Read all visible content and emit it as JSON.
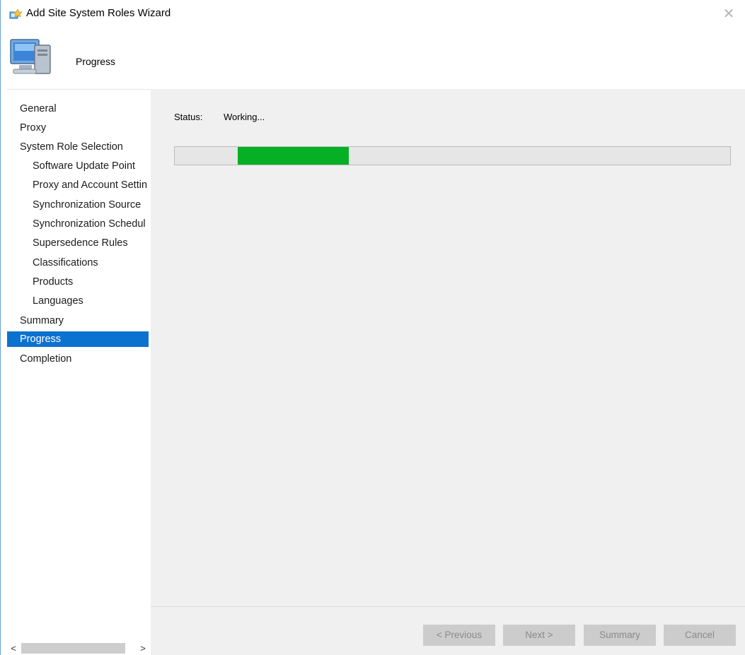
{
  "window": {
    "title": "Add Site System Roles Wizard"
  },
  "header": {
    "title": "Progress"
  },
  "nav": {
    "items": [
      {
        "label": "General"
      },
      {
        "label": "Proxy"
      },
      {
        "label": "System Role Selection"
      },
      {
        "label": "Software Update Point"
      },
      {
        "label": "Proxy and Account Settin"
      },
      {
        "label": "Synchronization Source"
      },
      {
        "label": "Synchronization Schedul"
      },
      {
        "label": "Supersedence Rules"
      },
      {
        "label": "Classifications"
      },
      {
        "label": "Products"
      },
      {
        "label": "Languages"
      },
      {
        "label": "Summary"
      },
      {
        "label": "Progress",
        "selected": true
      },
      {
        "label": "Completion"
      }
    ]
  },
  "status": {
    "label": "Status:",
    "value": "Working..."
  },
  "progress": {
    "indeterminate": true,
    "segment_start": 0.113,
    "segment_end": 0.313,
    "color": "#06b025"
  },
  "buttons": {
    "previous": "< Previous",
    "next": "Next >",
    "summary": "Summary",
    "cancel": "Cancel"
  },
  "colors": {
    "selection": "#0c72cf",
    "progress_fill": "#06b025"
  }
}
